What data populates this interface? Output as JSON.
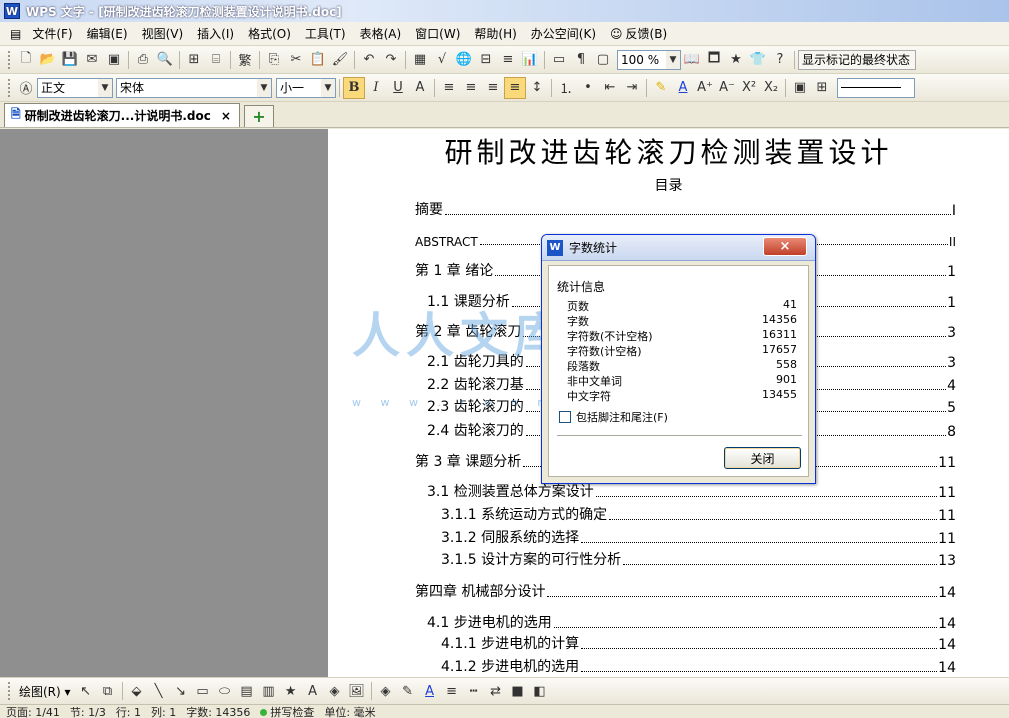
{
  "window": {
    "title": "WPS 文字 - [研制改进齿轮滚刀检测装置设计说明书.doc]"
  },
  "menu": [
    "文件(F)",
    "编辑(E)",
    "视图(V)",
    "插入(I)",
    "格式(O)",
    "工具(T)",
    "表格(A)",
    "窗口(W)",
    "帮助(H)",
    "办公空间(K)",
    "反馈(B)"
  ],
  "toolbar": {
    "zoom": "100 %",
    "track_mode": "显示标记的最终状态"
  },
  "format": {
    "style": "正文",
    "font": "宋体",
    "size": "小一"
  },
  "tabs": {
    "doc_tab": "研制改进齿轮滚刀...计说明书.doc",
    "close": "×",
    "new_tab": "+"
  },
  "document": {
    "title": "研制改进齿轮滚刀检测装置设计",
    "subtitle": "目录",
    "toc": [
      {
        "label": "摘要",
        "page": "I"
      },
      {
        "label": "ABSTRACT",
        "page": "II"
      },
      {
        "label": "第 1 章   绪论",
        "page": "1"
      },
      {
        "label": "1.1   课题分析",
        "page": "1"
      },
      {
        "label": "第 2 章  齿轮滚刀",
        "page": "3"
      },
      {
        "label": "2.1 齿轮刀具的",
        "page": "3"
      },
      {
        "label": "2.2 齿轮滚刀基",
        "page": "4"
      },
      {
        "label": "2.3 齿轮滚刀的",
        "page": "5"
      },
      {
        "label": "2.4 齿轮滚刀的",
        "page": "8"
      },
      {
        "label": "第 3 章  课题分析",
        "page": "11"
      },
      {
        "label": "3.1 检测装置总体方案设计",
        "page": "11"
      },
      {
        "label": "3.1.1 系统运动方式的确定",
        "page": "11"
      },
      {
        "label": "3.1.2 伺服系统的选择",
        "page": "11"
      },
      {
        "label": "3.1.5 设计方案的可行性分析",
        "page": "13"
      },
      {
        "label": "第四章   机械部分设计",
        "page": "14"
      },
      {
        "label": "4.1   步进电机的选用",
        "page": "14"
      },
      {
        "label": "4.1.1   步进电机的计算",
        "page": "14"
      },
      {
        "label": "4.1.2 步进电机的选用",
        "page": "14"
      }
    ]
  },
  "dialog": {
    "title": "字数统计",
    "close_x": "×",
    "group": "统计信息",
    "stats": [
      {
        "label": "页数",
        "value": "41"
      },
      {
        "label": "字数",
        "value": "14356"
      },
      {
        "label": "字符数(不计空格)",
        "value": "16311"
      },
      {
        "label": "字符数(计空格)",
        "value": "17657"
      },
      {
        "label": "段落数",
        "value": "558"
      },
      {
        "label": "非中文单词",
        "value": "901"
      },
      {
        "label": "中文字符",
        "value": "13455"
      }
    ],
    "checkbox": "包括脚注和尾注(F)",
    "close_button": "关闭"
  },
  "drawbar": {
    "draw_label": "绘图(R)"
  },
  "status": {
    "page": "页面: 1/41",
    "section": "节: 1/3",
    "line": "行: 1",
    "col": "列: 1",
    "words": "字数: 14356",
    "spell": "拼写检查",
    "unit": "单位: 毫米"
  },
  "watermark": {
    "text": "人人文库",
    "url": "w w w . r e n r e n d o c . c o m"
  }
}
